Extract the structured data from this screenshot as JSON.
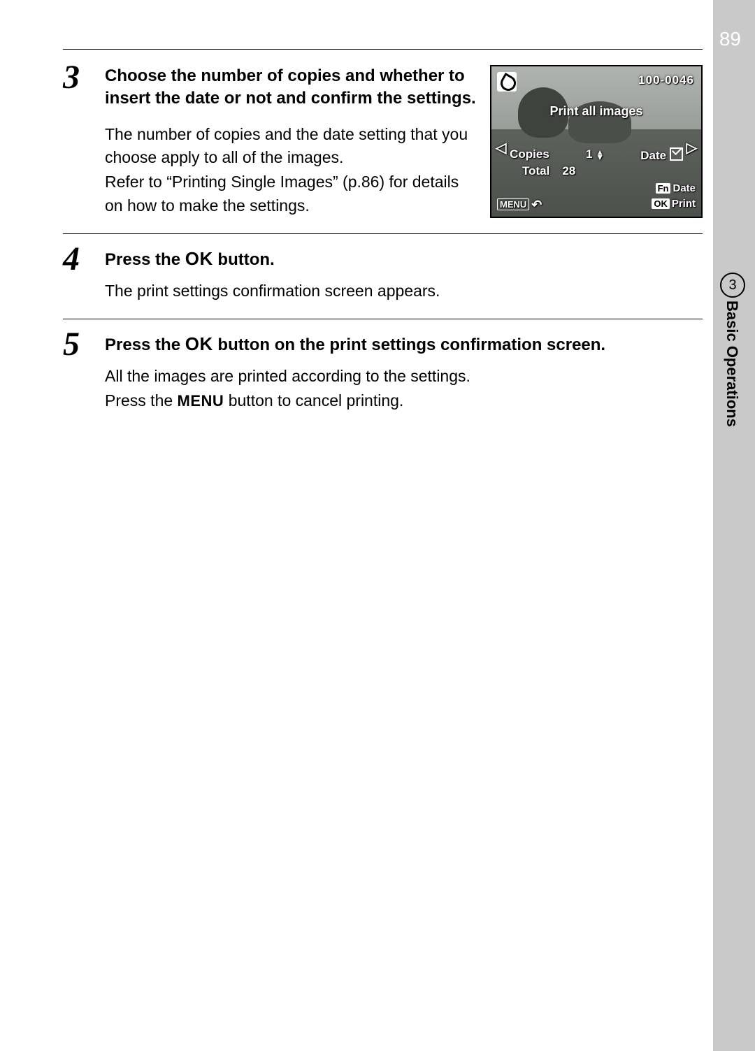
{
  "page_number": "89",
  "chapter": {
    "number": "3",
    "label": "Basic Operations"
  },
  "steps": [
    {
      "num": "3",
      "heading": "Choose the number of copies and whether to insert the date or not and confirm the settings.",
      "paras": [
        "The number of copies and the date setting that you choose apply to all of the images.",
        "Refer to “Printing Single Images” (p.86) for details on how to make the settings."
      ]
    },
    {
      "num": "4",
      "heading_pre": "Press the ",
      "heading_ok": "OK",
      "heading_post": " button.",
      "paras": [
        "The print settings confirmation screen appears."
      ]
    },
    {
      "num": "5",
      "heading_pre": "Press the ",
      "heading_ok": "OK",
      "heading_post": " button on the print settings confirmation screen.",
      "paras_mixed": {
        "line1": "All the images are printed according to the settings.",
        "line2_pre": "Press the ",
        "line2_menu": "MENU",
        "line2_post": " button to cancel printing."
      }
    }
  ],
  "lcd": {
    "folder_frame": "100-0046",
    "banner": "Print all images",
    "copies_label": "Copies",
    "copies_value": "1",
    "date_label": "Date",
    "date_checked": true,
    "total_label": "Total",
    "total_value": "28",
    "fn_chip": "Fn",
    "fn_label": "Date",
    "menu_chip": "MENU",
    "ok_chip": "OK",
    "ok_label": "Print",
    "arrow_left": "◁",
    "arrow_right": "▷",
    "spin_up": "▲",
    "spin_down": "▼",
    "return_glyph": "↶"
  }
}
